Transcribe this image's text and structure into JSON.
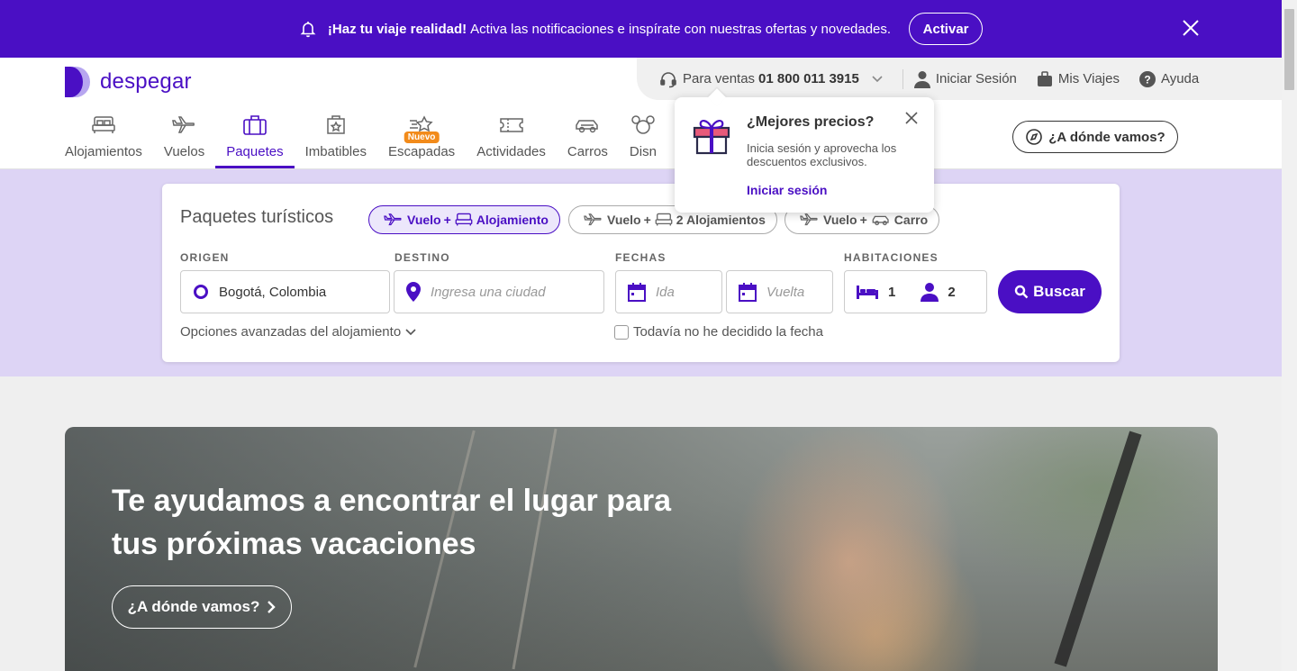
{
  "banner": {
    "headline": "¡Haz tu viaje realidad!",
    "text": "Activa las notificaciones e inspírate con nuestras ofertas y novedades.",
    "activate_label": "Activar"
  },
  "brand": {
    "name": "despegar",
    "color": "#4a0fc4"
  },
  "topbar": {
    "sales_label": "Para ventas",
    "sales_phone": "01 800 011 3915",
    "login_label": "Iniciar Sesión",
    "trips_label": "Mis Viajes",
    "help_label": "Ayuda"
  },
  "nav": {
    "tabs": [
      {
        "label": "Alojamientos",
        "icon": "bed-icon"
      },
      {
        "label": "Vuelos",
        "icon": "plane-icon"
      },
      {
        "label": "Paquetes",
        "icon": "suitcase-icon",
        "active": true
      },
      {
        "label": "Imbatibles",
        "icon": "deal-icon"
      },
      {
        "label": "Escapadas",
        "icon": "star-icon",
        "badge": "Nuevo"
      },
      {
        "label": "Actividades",
        "icon": "ticket-icon"
      },
      {
        "label": "Carros",
        "icon": "car-icon"
      },
      {
        "label": "Disn",
        "icon": "mouse-icon"
      }
    ],
    "where_label": "¿A dónde vamos?"
  },
  "popover": {
    "title": "¿Mejores precios?",
    "text": "Inicia sesión y aprovecha los descuentos exclusivos.",
    "link": "Iniciar sesión"
  },
  "search": {
    "title": "Paquetes turísticos",
    "plus": "+",
    "pills": [
      {
        "a": "Vuelo",
        "b": "Alojamiento",
        "active": true
      },
      {
        "a": "Vuelo",
        "b": "2 Alojamientos"
      },
      {
        "a": "Vuelo",
        "b": "Carro"
      }
    ],
    "labels": {
      "origin": "ORIGEN",
      "destination": "DESTINO",
      "dates": "FECHAS",
      "rooms": "HABITACIONES"
    },
    "origin_value": "Bogotá, Colombia",
    "destination_placeholder": "Ingresa una ciudad",
    "depart_placeholder": "Ida",
    "return_placeholder": "Vuelta",
    "rooms_count": "1",
    "people_count": "2",
    "search_label": "Buscar",
    "advanced_label": "Opciones avanzadas del alojamiento",
    "undecided_label": "Todavía no he decidido la fecha"
  },
  "hero": {
    "title": "Te ayudamos a encontrar el lugar para tus próximas vacaciones",
    "button_label": "¿A dónde vamos?"
  }
}
